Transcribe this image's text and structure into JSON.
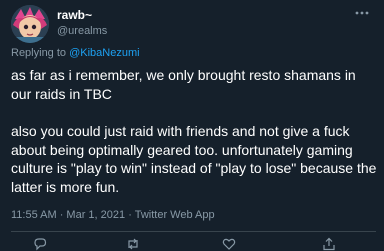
{
  "tweet": {
    "display_name": "rawb~",
    "handle": "@urealms",
    "more_icon": "more-icon",
    "reply_prefix": "Replying to",
    "reply_to": "@KibaNezumi",
    "paragraphs": [
      "as far as i remember, we only brought resto shamans in our raids in TBC",
      "also you could just raid with friends and not give a fuck about being optimally geared too. unfortunately gaming culture is \"play to win\" instead of \"play to lose\" because the latter is more fun."
    ],
    "meta": "11:55 AM · Mar 1, 2021 · Twitter Web App"
  },
  "actions": [
    "reply-icon",
    "retweet-icon",
    "like-icon",
    "share-icon"
  ],
  "colors": {
    "background": "#15202b",
    "text": "#ffffff",
    "secondary": "#8899a6",
    "link": "#1da1f2",
    "divider": "#38444d"
  }
}
